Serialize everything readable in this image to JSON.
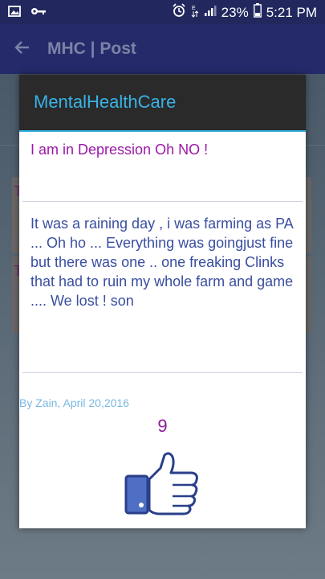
{
  "status_bar": {
    "battery_percent": "23%",
    "time": "5:21 PM",
    "icons": [
      "image-icon",
      "key-icon",
      "alarm-icon",
      "data-icon",
      "signal-icon",
      "battery-icon"
    ]
  },
  "app_bar": {
    "title": "MHC | Post",
    "back_icon": "arrow-left-icon"
  },
  "dialog": {
    "title": "MentalHealthCare",
    "post_title": "I am in Depression Oh NO !",
    "post_body": "It was a raining day , i was farming as PA ... Oh ho ... Everything was goingjust fine but there was one .. one freaking Clinks that had to ruin my whole farm and game .... We lost ! son",
    "meta": "By Zain, April 20,2016",
    "like_count": "9",
    "like_icon": "thumbs-up-icon"
  },
  "colors": {
    "dialog_title": "#39b3e6",
    "post_title": "#9c18a8",
    "post_body": "#3a4ea0",
    "like_count": "#8e1a96"
  }
}
